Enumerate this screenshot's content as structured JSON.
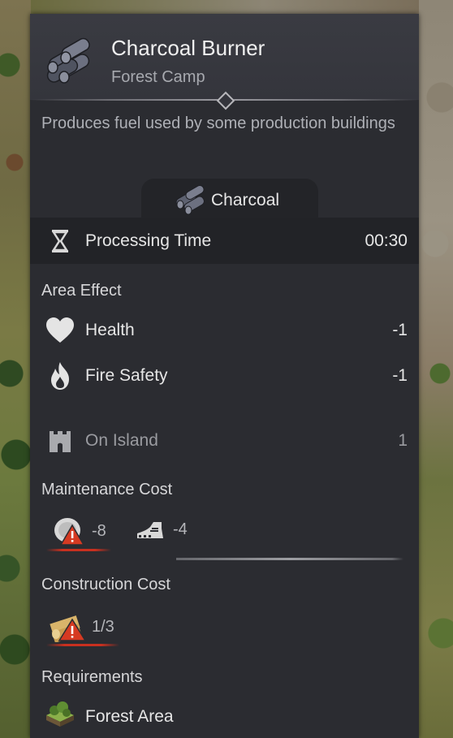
{
  "building": {
    "name": "Charcoal Burner",
    "category": "Forest Camp",
    "description": "Produces fuel used by some production buildings"
  },
  "product": {
    "name": "Charcoal",
    "icon": "charcoal-icon"
  },
  "processing": {
    "label": "Processing Time",
    "value": "00:30",
    "icon": "hourglass-icon"
  },
  "area_effect": {
    "heading": "Area Effect",
    "items": [
      {
        "label": "Health",
        "value": "-1",
        "icon": "heart-icon"
      },
      {
        "label": "Fire Safety",
        "value": "-1",
        "icon": "flame-icon"
      }
    ]
  },
  "limit": {
    "label": "On Island",
    "value": "1",
    "icon": "castle-icon"
  },
  "maintenance": {
    "heading": "Maintenance Cost",
    "items": [
      {
        "value": "-8",
        "icon": "coin-warning-icon",
        "warning": true
      },
      {
        "value": "-4",
        "icon": "workforce-boot-icon",
        "warning": false
      }
    ]
  },
  "construction": {
    "heading": "Construction Cost",
    "items": [
      {
        "value": "1/3",
        "icon": "timber-warning-icon",
        "warning": true
      }
    ]
  },
  "requirements": {
    "heading": "Requirements",
    "items": [
      {
        "label": "Forest Area",
        "icon": "forest-area-icon"
      }
    ]
  },
  "colors": {
    "panel": "#2b2c31",
    "warning_red": "#c8301f",
    "text": "#e6e6e6",
    "muted": "#9a9ba0"
  }
}
